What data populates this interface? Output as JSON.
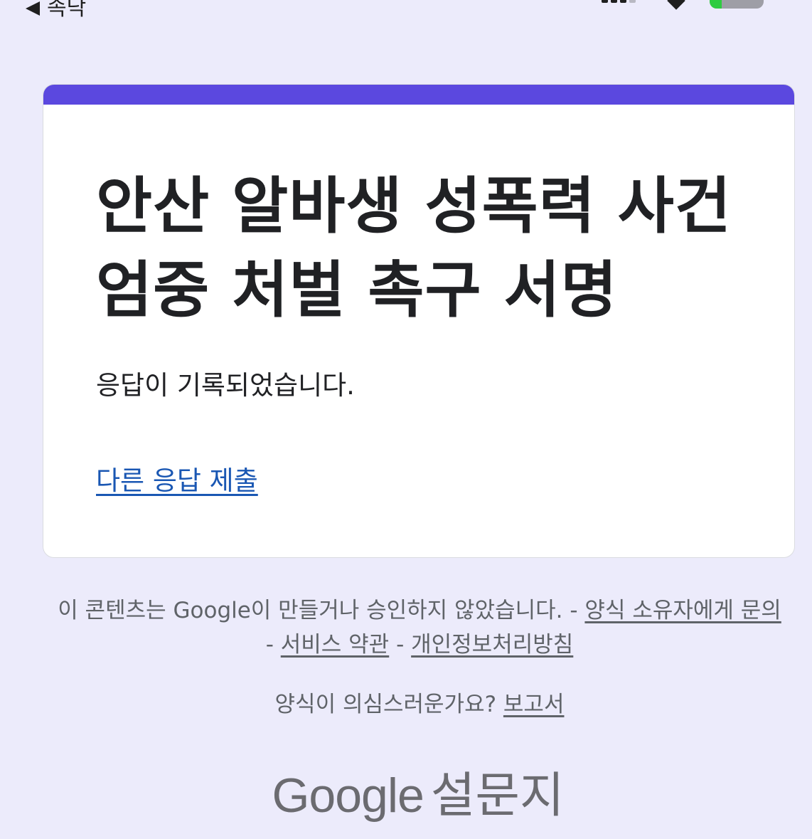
{
  "status_bar": {
    "back_label": "속닥",
    "battery_level": 0.22,
    "battery_color": "#2ecc40"
  },
  "form": {
    "title_line1": "안산 알바생 성폭력 사건",
    "title_line2": "엄중 처벌 촉구 서명",
    "confirmation_message": "응답이 기록되었습니다.",
    "submit_another_label": "다른 응답 제출",
    "accent_color": "#5b48df"
  },
  "footer": {
    "disclaimer_text": "이 콘텐츠는 Google이 만들거나 승인하지 않았습니다. -",
    "contact_owner_label": "양식 소유자에게 문의",
    "separator": "-",
    "terms_label": "서비스 약관",
    "privacy_label": "개인정보처리방침",
    "report_question": "양식이 의심스러운가요?",
    "report_label": "보고서"
  },
  "brand": {
    "google": "Google",
    "product": "설문지"
  }
}
